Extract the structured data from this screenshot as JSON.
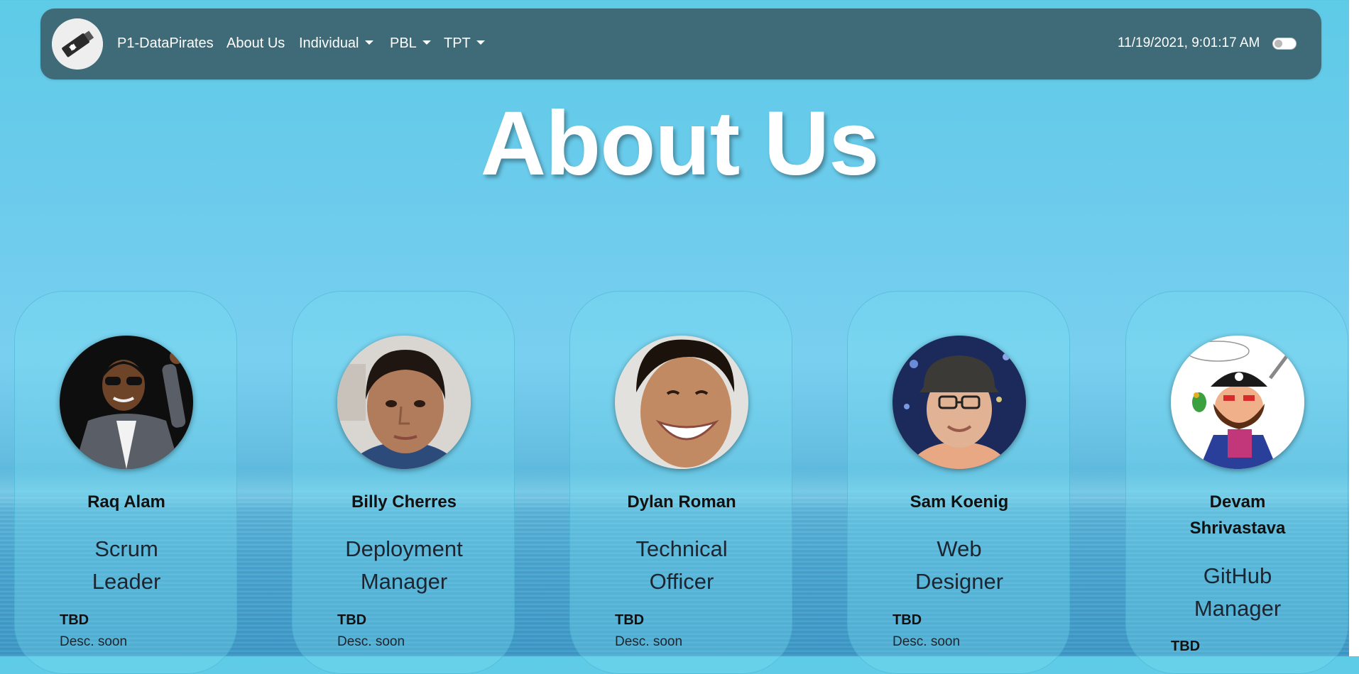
{
  "navbar": {
    "brand": "P1-DataPirates",
    "about_us": "About Us",
    "individual": "Individual",
    "pbl": "PBL",
    "tpt": "TPT",
    "datetime": "11/19/2021, 9:01:17 AM",
    "theme_toggle_on": false
  },
  "page": {
    "title": "About Us"
  },
  "members": [
    {
      "name": "Raq Alam",
      "role_line1": "Scrum",
      "role_line2": "Leader",
      "status": "TBD",
      "desc": "Desc. soon"
    },
    {
      "name": "Billy Cherres",
      "role_line1": "Deployment",
      "role_line2": "Manager",
      "status": "TBD",
      "desc": "Desc. soon"
    },
    {
      "name": "Dylan Roman",
      "role_line1": "Technical",
      "role_line2": "Officer",
      "status": "TBD",
      "desc": "Desc. soon"
    },
    {
      "name": "Sam Koenig",
      "role_line1": "Web",
      "role_line2": "Designer",
      "status": "TBD",
      "desc": "Desc. soon"
    },
    {
      "name_line1": "Devam",
      "name_line2": "Shrivastava",
      "role_line1": "GitHub",
      "role_line2": "Manager",
      "status": "TBD"
    }
  ],
  "colors": {
    "navbar_bg": "#3e6b77",
    "sky": "#6ccbec",
    "sea": "#3d98c6"
  }
}
